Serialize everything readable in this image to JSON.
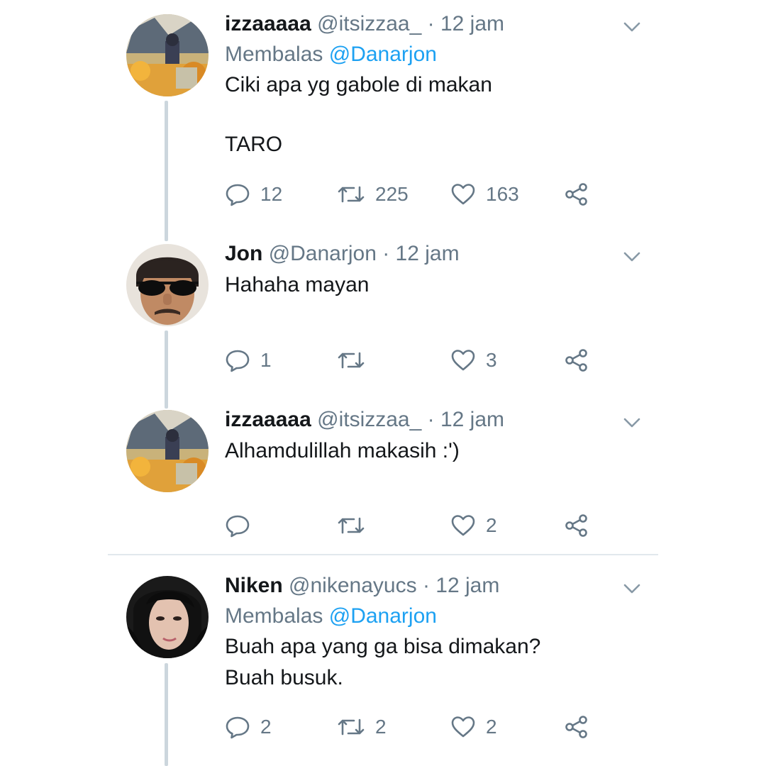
{
  "tweets": [
    {
      "name": "izzaaaaa",
      "handle": "@itsizzaa_",
      "time": "· 12 jam",
      "reply_prefix": "Membalas",
      "reply_mention": "@Danarjon",
      "text_lines": [
        "Ciki apa yg gabole di makan",
        "TARO"
      ],
      "replies": "12",
      "retweets": "225",
      "likes": "163",
      "avatar": "izza-avatar"
    },
    {
      "name": "Jon",
      "handle": "@Danarjon",
      "time": "· 12 jam",
      "text_lines": [
        "Hahaha mayan"
      ],
      "replies": "1",
      "retweets": "",
      "likes": "3",
      "avatar": "jon-avatar"
    },
    {
      "name": "izzaaaaa",
      "handle": "@itsizzaa_",
      "time": "· 12 jam",
      "text_lines": [
        "Alhamdulillah makasih :')"
      ],
      "replies": "",
      "retweets": "",
      "likes": "2",
      "avatar": "izza-avatar"
    },
    {
      "name": "Niken",
      "handle": "@nikenayucs",
      "time": "· 12 jam",
      "reply_prefix": "Membalas",
      "reply_mention": "@Danarjon",
      "text_lines": [
        "Buah apa yang ga bisa dimakan?",
        "Buah busuk."
      ],
      "replies": "2",
      "retweets": "2",
      "likes": "2",
      "avatar": "niken-avatar"
    }
  ],
  "icons": {
    "reply": "reply-icon",
    "retweet": "retweet-icon",
    "like": "heart-icon",
    "share": "share-icon",
    "caret": "chevron-down-icon"
  },
  "colors": {
    "text": "#14171a",
    "secondary": "#657786",
    "link": "#1da1f2",
    "thread_line": "#ccd6dd"
  }
}
